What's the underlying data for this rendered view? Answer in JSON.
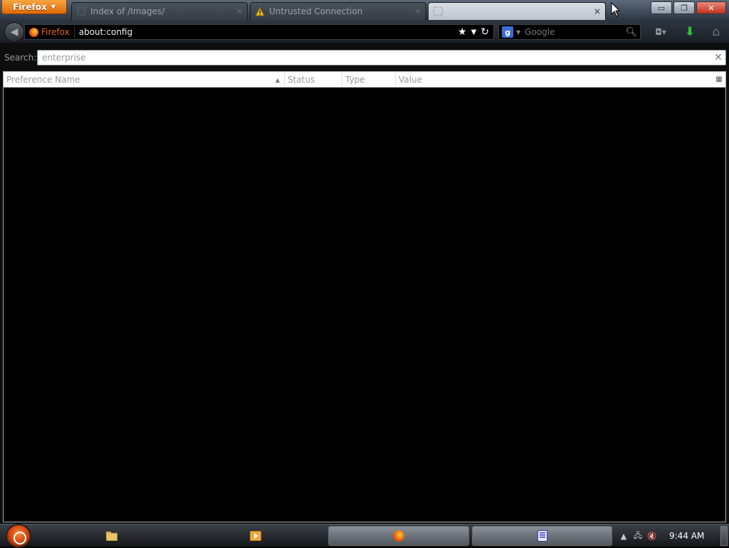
{
  "browser": {
    "menu_button": "Firefox",
    "tabs": [
      {
        "title": "Index of /Images/",
        "active": false
      },
      {
        "title": "Untrusted Connection",
        "active": false,
        "icon": "warning-icon"
      },
      {
        "title": "",
        "active": true
      }
    ],
    "tab_close_glyph": "×",
    "window_controls": {
      "minimize": "▭",
      "maximize": "❐",
      "close": "✕"
    }
  },
  "navbar": {
    "back_glyph": "◀",
    "identity_label": "Firefox",
    "url": "about:config",
    "search_engine": "g",
    "search_placeholder": "Google",
    "addon_glyph": "◘▾",
    "download_glyph": "⬇",
    "home_glyph": "⌂"
  },
  "config": {
    "search_label": "Search:",
    "search_value": "enterprise",
    "clear_glyph": "✕",
    "columns": [
      "Preference Name",
      "Status",
      "Type",
      "Value"
    ],
    "sort_glyph": "▲",
    "column_picker_glyph": "▦",
    "rows": []
  },
  "taskbar": {
    "clock": "9:44 AM",
    "tray_icons": [
      "show-hidden-icon",
      "network-icon",
      "volume-muted-icon"
    ],
    "tray_glyphs": [
      "▲",
      "🖧",
      "🔇"
    ]
  },
  "colors": {
    "firefox_orange": "#e8700a",
    "download_green": "#2ec23a",
    "content_bg": "#000000"
  }
}
